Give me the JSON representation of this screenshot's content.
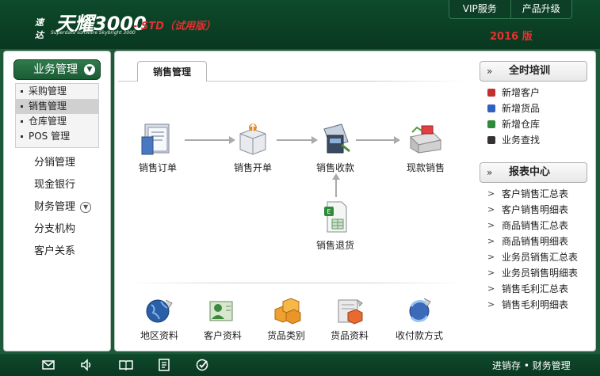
{
  "header": {
    "logo_prefix": "速达",
    "logo_main": "天耀3000",
    "logo_sub": "Superdata software Skybright 3000",
    "edition": "- STD（试用版）",
    "year": "2016 版",
    "buttons": [
      "VIP服务",
      "产品升级"
    ]
  },
  "sidebar": {
    "head": "业务管理",
    "submenu": [
      "采购管理",
      "销售管理",
      "仓库管理",
      "POS 管理"
    ],
    "active_sub": "销售管理",
    "menu": [
      "分销管理",
      "现金银行",
      "财务管理",
      "分支机构",
      "客户关系"
    ]
  },
  "main": {
    "tab": "销售管理",
    "flow": [
      "销售订单",
      "销售开单",
      "销售收款",
      "现款销售",
      "销售退货"
    ],
    "bottom": [
      "地区资料",
      "客户资料",
      "货品类别",
      "货品资料",
      "收付款方式"
    ]
  },
  "training": {
    "title": "全时培训",
    "items": [
      "新增客户",
      "新增货品",
      "新增仓库",
      "业务查找"
    ]
  },
  "reports": {
    "title": "报表中心",
    "items": [
      "客户销售汇总表",
      "客户销售明细表",
      "商品销售汇总表",
      "商品销售明细表",
      "业务员销售汇总表",
      "业务员销售明细表",
      "销售毛利汇总表",
      "销售毛利明细表"
    ]
  },
  "footer": {
    "text": "进销存 • 财务管理",
    "icons": [
      "mail-icon",
      "sound-icon",
      "book-icon",
      "document-icon",
      "check-icon"
    ]
  }
}
